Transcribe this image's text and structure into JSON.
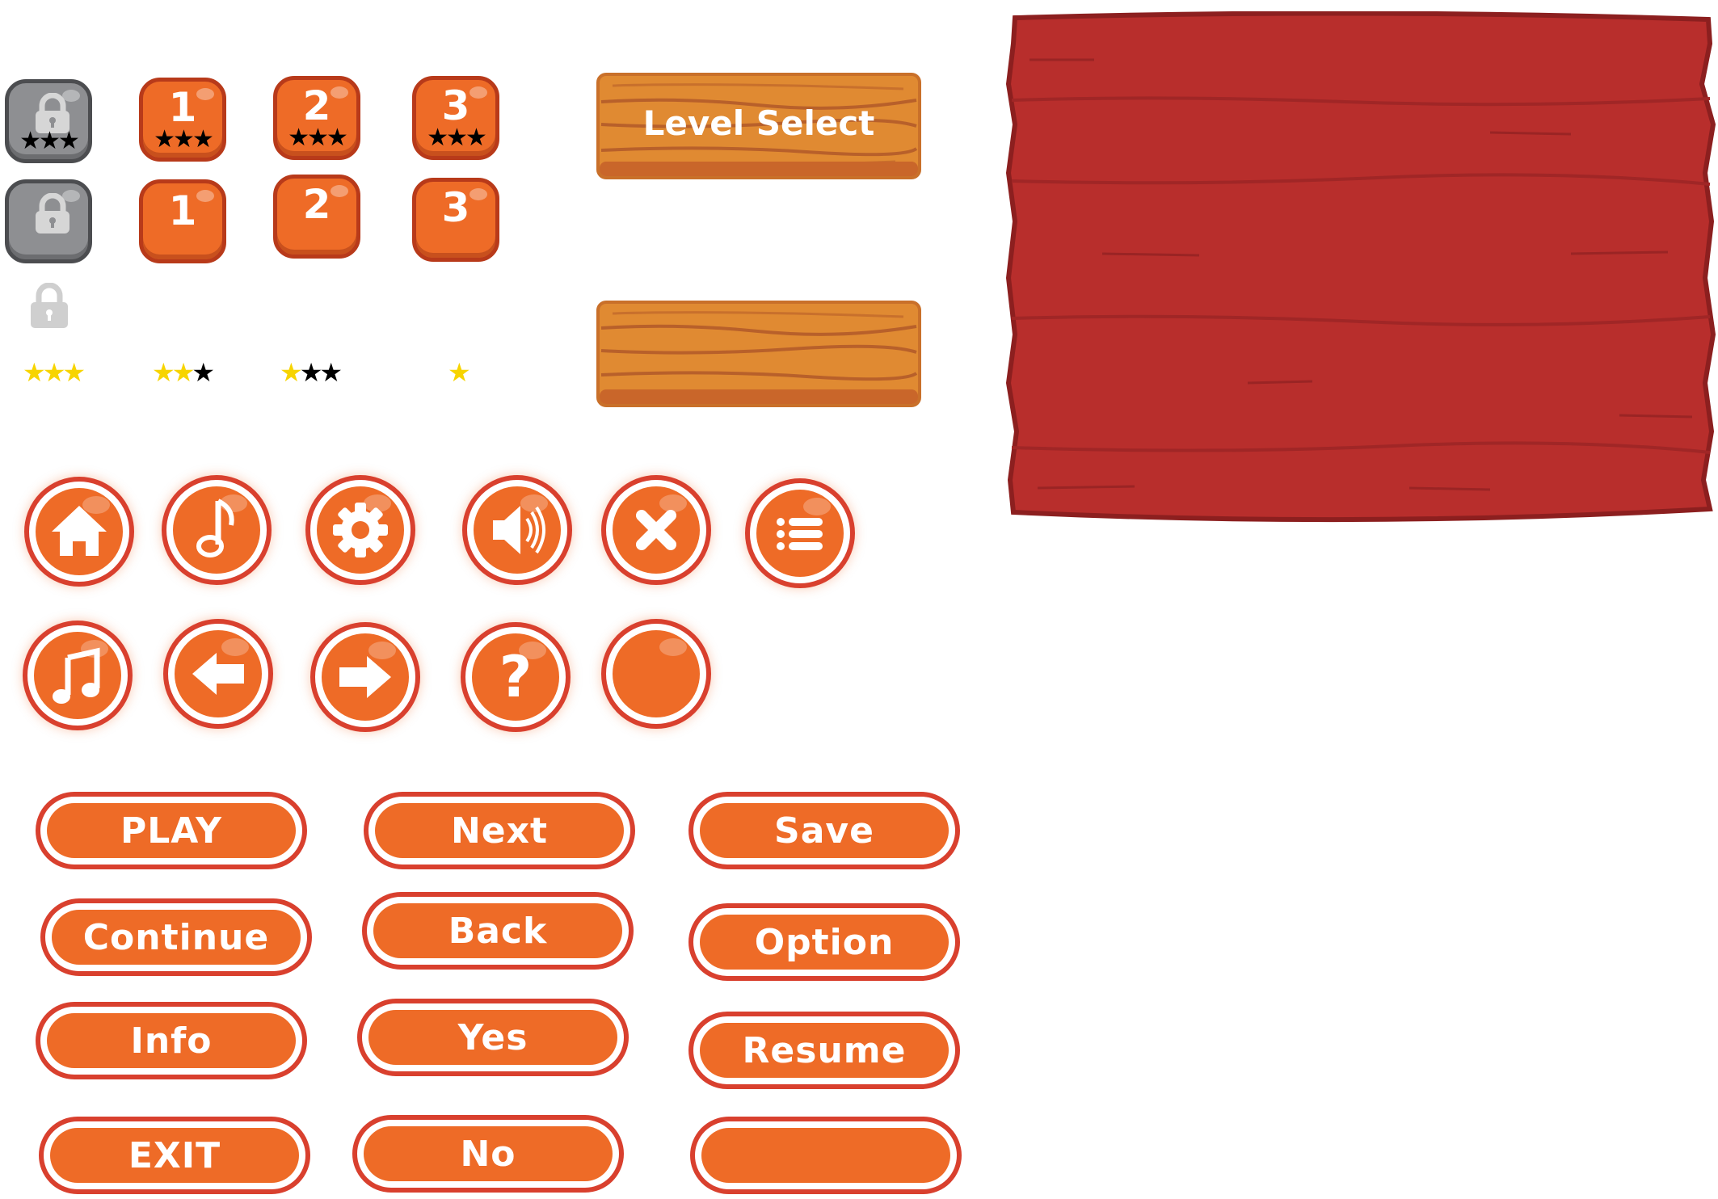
{
  "colors": {
    "orange": "#ee6b27",
    "orange_dark": "#b83a1a",
    "button_ring": "#d9402e",
    "gray_tile": "#8e8f92",
    "star_gold": "#f7d400",
    "star_black": "#000000",
    "wood_light": "#d9832f",
    "wood_dark": "#c0652a",
    "board_red": "#b82e2c"
  },
  "level_tiles": {
    "row1": [
      {
        "type": "locked",
        "icon": "lock-icon",
        "stars": "★★★"
      },
      {
        "type": "level",
        "number": "1",
        "stars": "★★★"
      },
      {
        "type": "level",
        "number": "2",
        "stars": "★★★"
      },
      {
        "type": "level",
        "number": "3",
        "stars": "★★★"
      }
    ],
    "row2": [
      {
        "type": "locked",
        "icon": "lock-icon"
      },
      {
        "type": "level",
        "number": "1"
      },
      {
        "type": "level",
        "number": "2"
      },
      {
        "type": "level",
        "number": "3"
      }
    ],
    "lock_icon": "lock-icon"
  },
  "star_ratings": [
    {
      "filled": 3,
      "total": 3,
      "gold": "★★★",
      "black": ""
    },
    {
      "filled": 2,
      "total": 3,
      "gold": "★★",
      "black": "★"
    },
    {
      "filled": 1,
      "total": 3,
      "gold": "★",
      "black": "★★"
    },
    {
      "filled": 1,
      "total": 1,
      "gold": "★",
      "black": ""
    }
  ],
  "planks": {
    "level_select_label": "Level Select",
    "blank_label": ""
  },
  "icon_buttons": {
    "row1": [
      "home-icon",
      "music-note-icon",
      "settings-gear-icon",
      "sound-on-icon",
      "close-icon",
      "menu-list-icon"
    ],
    "row2": [
      "music-icon",
      "arrow-left-icon",
      "arrow-right-icon",
      "help-question-icon",
      "blank-icon"
    ],
    "help_glyph": "?"
  },
  "text_buttons": {
    "col1": [
      "PLAY",
      "Continue",
      "Info",
      "EXIT"
    ],
    "col2": [
      "Next",
      "Back",
      "Yes",
      "No"
    ],
    "col3": [
      "Save",
      "Option",
      "Resume",
      ""
    ]
  }
}
